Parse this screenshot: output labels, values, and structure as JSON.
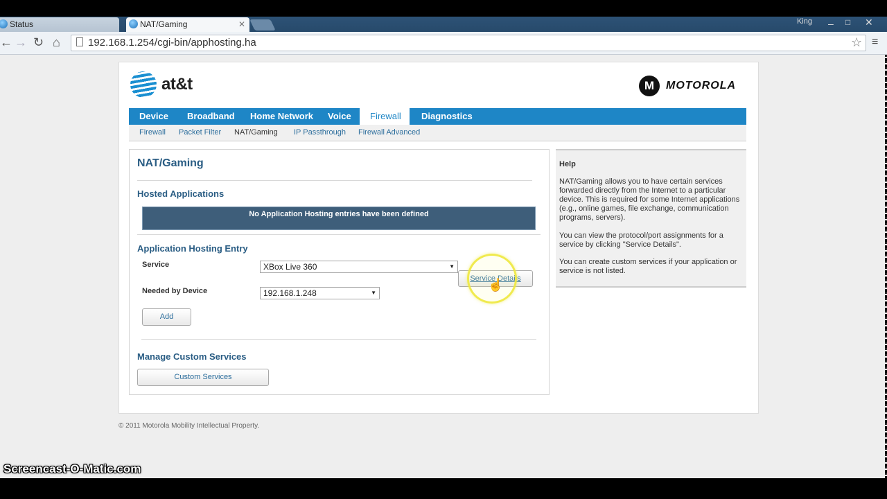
{
  "browser": {
    "tabs": [
      {
        "label": "Status"
      },
      {
        "label": "NAT/Gaming"
      }
    ],
    "user_name": "King",
    "address": "192.168.1.254/cgi-bin/apphosting.ha"
  },
  "brand": {
    "att": "at&t",
    "motorola": "MOTOROLA",
    "motorola_symbol": "M"
  },
  "main_nav": [
    "Device",
    "Broadband",
    "Home Network",
    "Voice",
    "Firewall",
    "Diagnostics"
  ],
  "main_nav_active": "Firewall",
  "sub_nav": [
    "Firewall",
    "Packet Filter",
    "NAT/Gaming",
    "IP Passthrough",
    "Firewall Advanced"
  ],
  "sub_nav_active": "NAT/Gaming",
  "page": {
    "title": "NAT/Gaming",
    "hosted_heading": "Hosted Applications",
    "no_entries": "No Application Hosting entries have been defined",
    "entry_heading": "Application Hosting Entry",
    "service_label": "Service",
    "service_value": "XBox Live 360",
    "device_label": "Needed by Device",
    "device_value": "192.168.1.248",
    "service_details_button": "Service Details",
    "add_button": "Add",
    "manage_heading": "Manage Custom Services",
    "custom_services_button": "Custom Services"
  },
  "help": {
    "title": "Help",
    "p1": "NAT/Gaming allows you to have certain services forwarded directly from the Internet to a particular device. This is required for some Internet applications (e.g., online games, file exchange, communication programs, servers).",
    "p2": "You can view the protocol/port assignments for a service by clicking \"Service Details\".",
    "p3": "You can create custom services if your application or service is not listed."
  },
  "footer": "© 2011 Motorola Mobility Intellectual Property.",
  "watermark": "Screencast-O-Matic.com",
  "colors": {
    "nav_blue": "#1e86c6",
    "heading_blue": "#2a5d84",
    "banner_bg": "#3e5e7a",
    "highlight_ring": "#eee83c"
  }
}
